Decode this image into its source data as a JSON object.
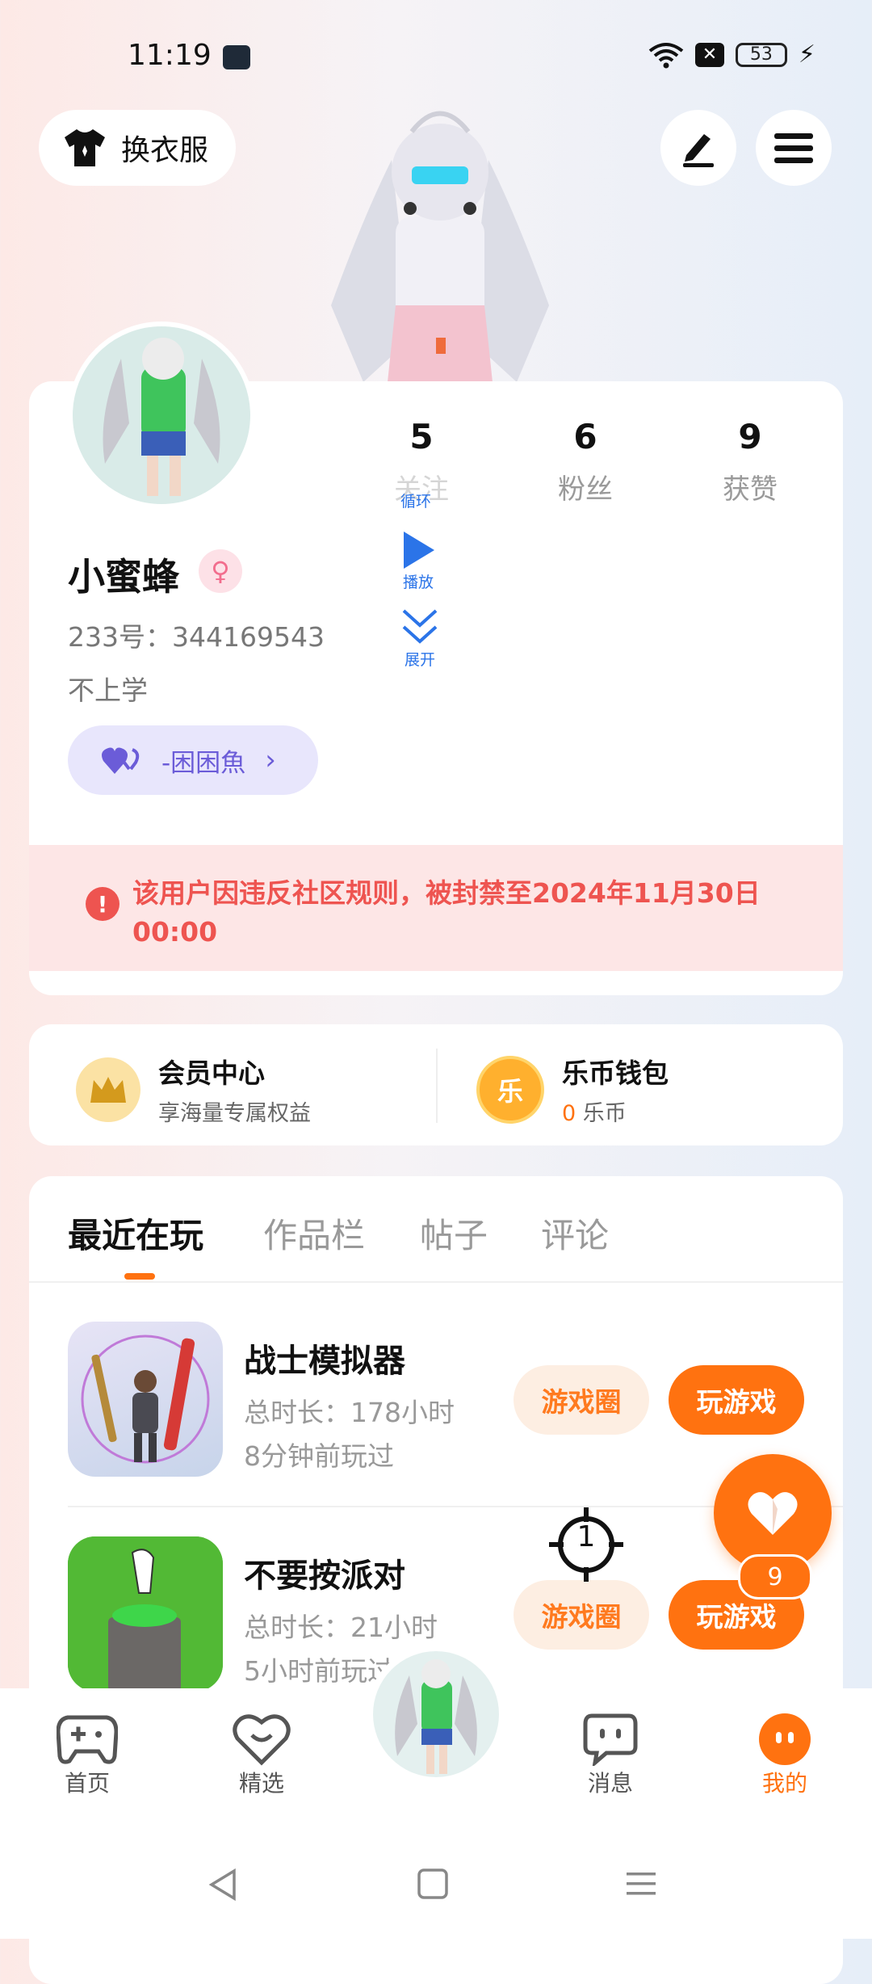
{
  "status": {
    "time": "11:19",
    "battery": "53"
  },
  "header": {
    "dress_label": "换衣服"
  },
  "profile": {
    "stats": [
      {
        "value": "5",
        "label": "关注"
      },
      {
        "value": "6",
        "label": "粉丝"
      },
      {
        "value": "9",
        "label": "获赞"
      }
    ],
    "username": "小蜜蜂",
    "gender_symbol": "♀",
    "uid": "233号：344169543",
    "bio": "不上学",
    "guild": "-困困魚",
    "media": {
      "loop": "循环",
      "play": "播放",
      "expand": "展开"
    },
    "ban_notice": "该用户因违反社区规则，被封禁至2024年11月30日 00:00"
  },
  "wallet": {
    "member_title": "会员中心",
    "member_sub": "享海量专属权益",
    "coin_title": "乐币钱包",
    "coin_amount": "0",
    "coin_unit": "乐币",
    "coin_glyph": "乐"
  },
  "tabs": [
    "最近在玩",
    "作品栏",
    "帖子",
    "评论"
  ],
  "games": [
    {
      "title": "战士模拟器",
      "duration": "总时长：178小时",
      "last_played": "8分钟前玩过",
      "circle_label": "游戏圈",
      "play_label": "玩游戏"
    },
    {
      "title": "不要按派对",
      "duration": "总时长：21小时",
      "last_played": "5小时前玩过",
      "circle_label": "游戏圈",
      "play_label": "玩游戏"
    }
  ],
  "fab": {
    "count": "9"
  },
  "crosshair_label": "1",
  "nav": [
    {
      "label": "首页",
      "icon": "gamepad-icon"
    },
    {
      "label": "精选",
      "icon": "heart-badge-icon"
    },
    {
      "label": "消息",
      "icon": "chat-bubble-icon"
    },
    {
      "label": "我的",
      "icon": "face-icon",
      "active": true
    }
  ],
  "colors": {
    "accent": "#ff7210",
    "ban": "#ee5450",
    "guild": "#6b5cd8"
  }
}
